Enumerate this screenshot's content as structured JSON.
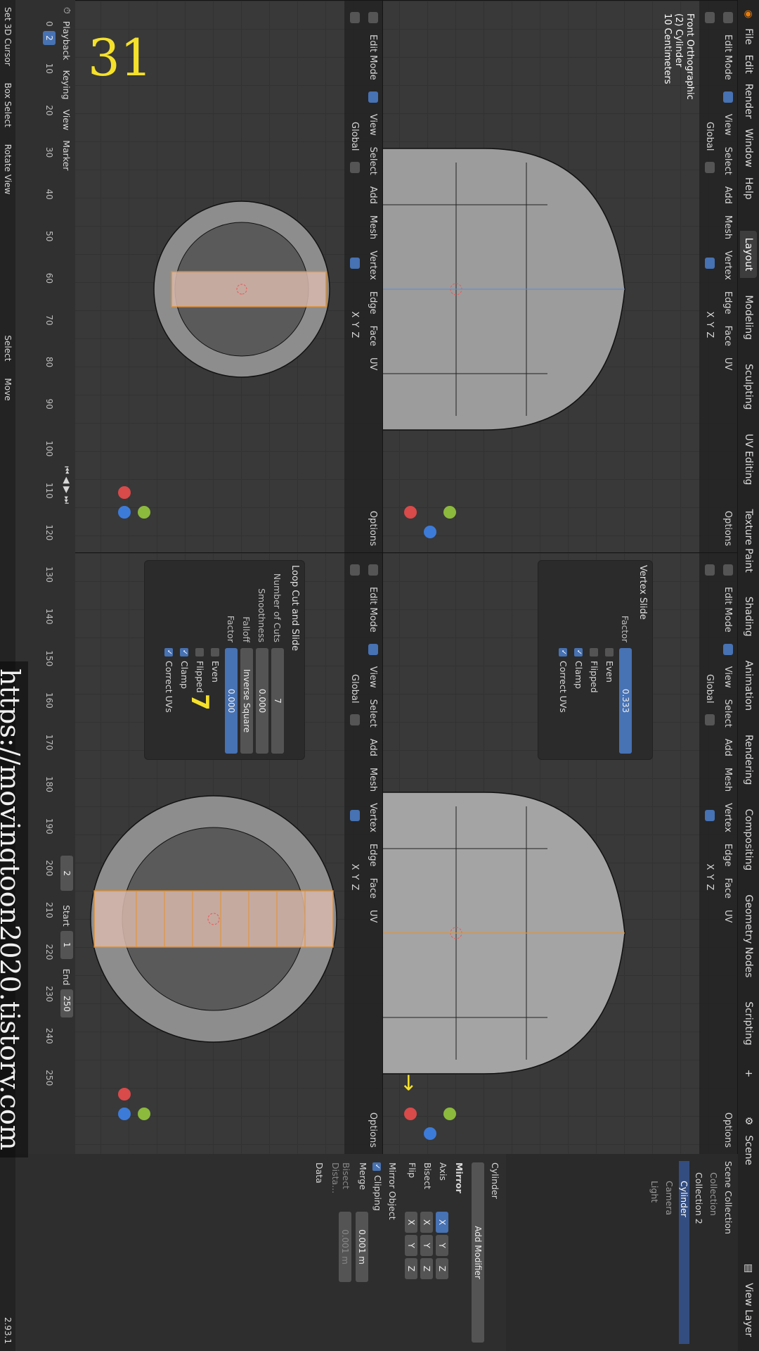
{
  "menu": [
    "File",
    "Edit",
    "Render",
    "Window",
    "Help"
  ],
  "workspaces": [
    "Layout",
    "Modeling",
    "Sculpting",
    "UV Editing",
    "Texture Paint",
    "Shading",
    "Animation",
    "Rendering",
    "Compositing",
    "Geometry Nodes",
    "Scripting"
  ],
  "active_workspace": "Layout",
  "scene": "Scene",
  "view_layer": "View Layer",
  "viewport_header": {
    "mode": "Edit Mode",
    "menus": [
      "View",
      "Select",
      "Add",
      "Mesh",
      "Vertex",
      "Edge",
      "Face",
      "UV"
    ],
    "transform": "Global",
    "options": "Options",
    "axes": [
      "X",
      "Y",
      "Z"
    ]
  },
  "viewport_overlay": {
    "line1": "Front Orthographic",
    "line2": "(2) Cylinder",
    "line3": "10 Centimeters"
  },
  "step_number": "31",
  "annotation_number": "7",
  "watermark": "https://movingtoon2020.tistory.com",
  "vertex_slide": {
    "title": "Vertex Slide",
    "factor_label": "Factor",
    "factor_value": "0.333",
    "even": "Even",
    "flipped": "Flipped",
    "clamp": "Clamp",
    "correct_uvs": "Correct UVs"
  },
  "loop_cut": {
    "title": "Loop Cut and Slide",
    "cuts_label": "Number of Cuts",
    "cuts_value": "7",
    "smooth_label": "Smoothness",
    "smooth_value": "0.000",
    "falloff_label": "Falloff",
    "falloff_value": "Inverse Square",
    "factor_label": "Factor",
    "factor_value": "0.000",
    "even": "Even",
    "flipped": "Flipped",
    "clamp": "Clamp",
    "correct_uvs": "Correct UVs"
  },
  "timeline": {
    "playback": "Playback",
    "keying": "Keying",
    "view": "View",
    "marker": "Marker",
    "current_frame": "2",
    "frame_display": "2",
    "start_label": "Start",
    "start_value": "1",
    "end_label": "End",
    "end_value": "250",
    "ticks": [
      "0",
      "10",
      "20",
      "30",
      "40",
      "50",
      "60",
      "70",
      "80",
      "90",
      "100",
      "110",
      "120",
      "130",
      "140",
      "150",
      "160",
      "170",
      "180",
      "190",
      "200",
      "210",
      "220",
      "230",
      "240",
      "250"
    ]
  },
  "status_bar": {
    "items": [
      "Set 3D Cursor",
      "Box Select",
      "Rotate View",
      "Select",
      "Move"
    ],
    "version": "2.93.1"
  },
  "outliner": {
    "root": "Scene Collection",
    "items": [
      "Collection",
      "Collection 2",
      "Cylinder",
      "Camera",
      "Light"
    ],
    "selected": "Cylinder"
  },
  "properties": {
    "object": "Cylinder",
    "modifier_name": "Mirror",
    "add_modifier": "Add Modifier",
    "mirror_label": "Mirror",
    "axis_label": "Axis",
    "bisect_label": "Bisect",
    "flip_label": "Flip",
    "xyz": [
      "X",
      "Y",
      "Z"
    ],
    "mirror_object_label": "Mirror Object",
    "clipping_label": "Clipping",
    "merge_label": "Merge",
    "merge_value": "0.001 m",
    "bisect_distance_label": "Bisect Dista...",
    "bisect_distance_value": "0.001 m",
    "data_label": "Data"
  }
}
